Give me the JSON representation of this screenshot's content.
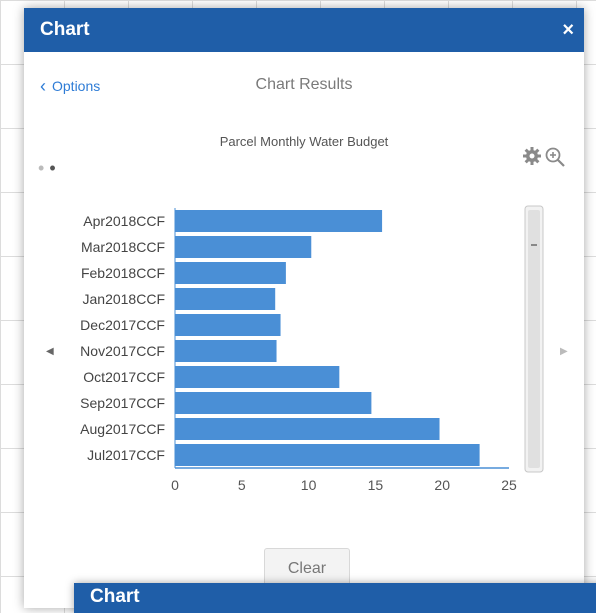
{
  "panel": {
    "title": "Chart",
    "close_glyph": "×",
    "back_label": "Options",
    "results_title": "Chart Results",
    "clear_label": "Clear"
  },
  "second_panel": {
    "title": "Chart"
  },
  "icons": {
    "back": "chevron-left-icon",
    "settings": "gear-icon",
    "zoom": "zoom-in-icon",
    "prev": "triangle-left-icon",
    "next": "triangle-right-icon"
  },
  "colors": {
    "titlebar": "#1f5ea8",
    "bar": "#4a8fd6",
    "link": "#2e7cd6"
  },
  "chart_data": {
    "type": "bar",
    "orientation": "horizontal",
    "title": "Parcel Monthly Water Budget",
    "categories": [
      "Apr2018CCF",
      "Mar2018CCF",
      "Feb2018CCF",
      "Jan2018CCF",
      "Dec2017CCF",
      "Nov2017CCF",
      "Oct2017CCF",
      "Sep2017CCF",
      "Aug2017CCF",
      "Jul2017CCF"
    ],
    "values": [
      15.5,
      10.2,
      8.3,
      7.5,
      7.9,
      7.6,
      12.3,
      14.7,
      19.8,
      22.8
    ],
    "xlim": [
      0,
      25
    ],
    "xticks": [
      "0",
      "5",
      "10",
      "15",
      "20",
      "25"
    ],
    "xlabel": "",
    "ylabel": "",
    "grid": false
  }
}
